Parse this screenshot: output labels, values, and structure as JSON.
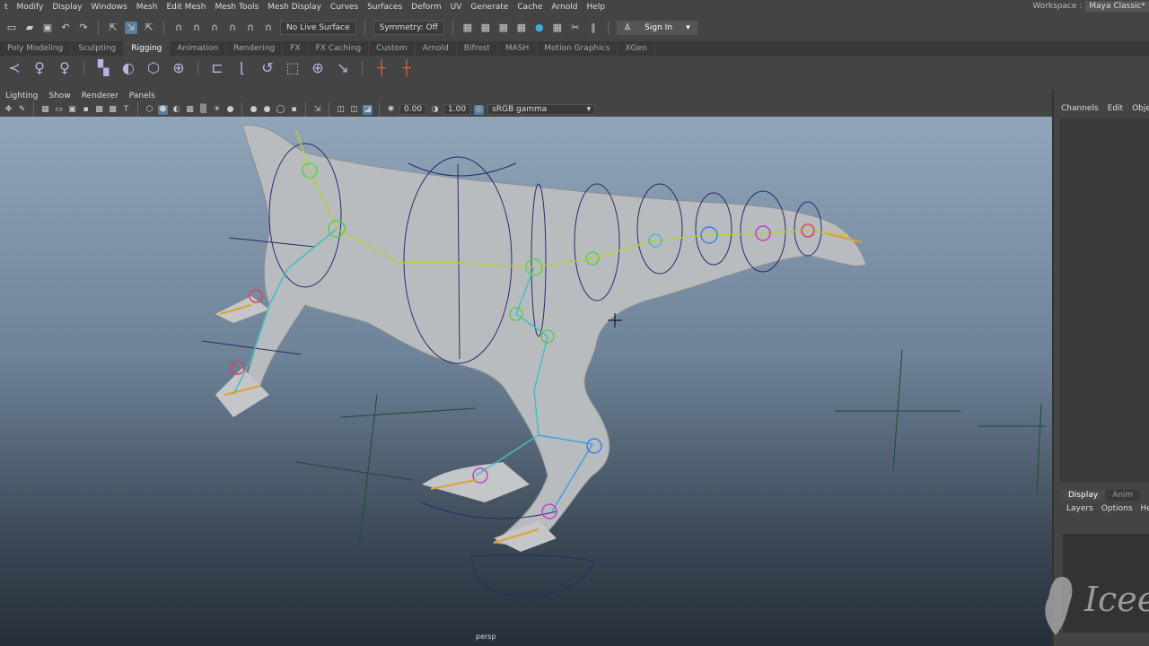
{
  "menubar": {
    "items": [
      "t",
      "Modify",
      "Display",
      "Windows",
      "Mesh",
      "Edit Mesh",
      "Mesh Tools",
      "Mesh Display",
      "Curves",
      "Surfaces",
      "Deform",
      "UV",
      "Generate",
      "Cache",
      "Arnold",
      "Help"
    ],
    "workspace_label": "Workspace :",
    "workspace_value": "Maya Classic*"
  },
  "statusline": {
    "live_surface": "No Live Surface",
    "symmetry": "Symmetry: Off",
    "sign_in": "Sign In"
  },
  "shelf_tabs": {
    "items": [
      "Poly Modeling",
      "Sculpting",
      "Rigging",
      "Animation",
      "Rendering",
      "FX",
      "FX Caching",
      "Custom",
      "Arnold",
      "Bifrost",
      "MASH",
      "Motion Graphics",
      "XGen"
    ],
    "active": "Rigging"
  },
  "panel": {
    "menu": [
      "Lighting",
      "Show",
      "Renderer",
      "Panels"
    ],
    "exposure": "0.00",
    "gamma": "1.00",
    "color_space": "sRGB gamma",
    "camera": "persp"
  },
  "channel_box": {
    "tabs": [
      "Channels",
      "Edit",
      "Obje"
    ]
  },
  "layer_editor": {
    "tabs": [
      "Display",
      "Anim"
    ],
    "active": "Display",
    "menu": [
      "Layers",
      "Options",
      "He"
    ]
  },
  "watermark": "Icee"
}
